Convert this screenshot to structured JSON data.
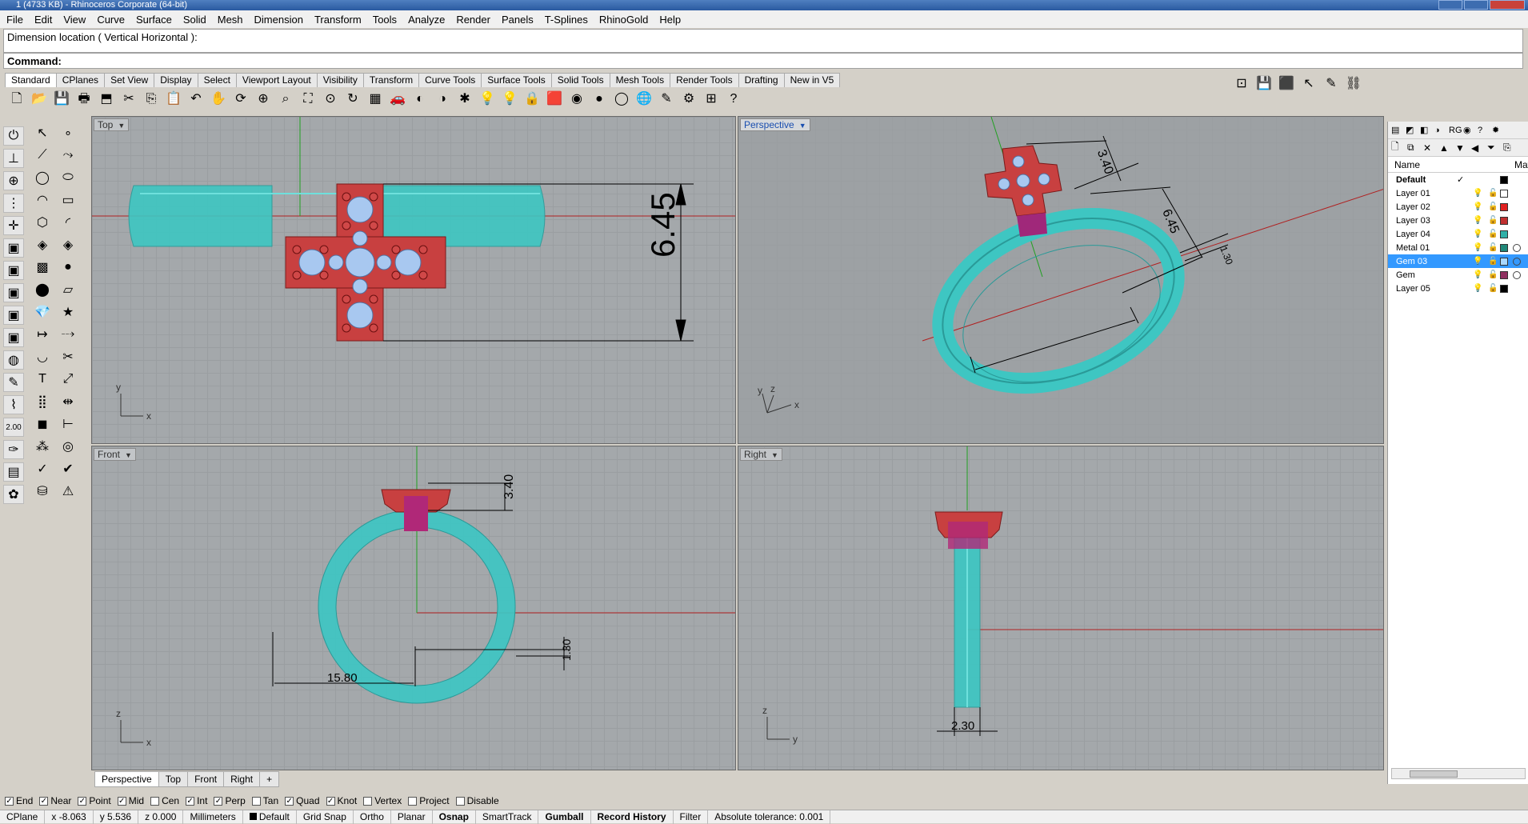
{
  "title": "1 (4733 KB) - Rhinoceros Corporate (64-bit)",
  "menu": [
    "File",
    "Edit",
    "View",
    "Curve",
    "Surface",
    "Solid",
    "Mesh",
    "Dimension",
    "Transform",
    "Tools",
    "Analyze",
    "Render",
    "Panels",
    "T-Splines",
    "RhinoGold",
    "Help"
  ],
  "command_history": "Dimension location ( Vertical  Horizontal ):",
  "command_prompt": "Command:",
  "toolbar_tabs": [
    "Standard",
    "CPlanes",
    "Set View",
    "Display",
    "Select",
    "Viewport Layout",
    "Visibility",
    "Transform",
    "Curve Tools",
    "Surface Tools",
    "Solid Tools",
    "Mesh Tools",
    "Render Tools",
    "Drafting",
    "New in V5"
  ],
  "toolbar_icons": [
    "new-icon",
    "open-icon",
    "save-icon",
    "print-icon",
    "import-icon",
    "cut-icon",
    "copy-icon",
    "paste-icon",
    "undo-icon",
    "pan-icon",
    "rotate-icon",
    "zoom-in-icon",
    "zoom-window-icon",
    "zoom-extents-icon",
    "zoom-selected-icon",
    "rotate-view-icon",
    "grid-icon",
    "car-icon",
    "hide-icon",
    "show-icon",
    "explode-icon",
    "light-icon",
    "light2-icon",
    "lock-icon",
    "render-icon",
    "color-wheel-icon",
    "sphere-icon",
    "sphere2-icon",
    "globe-icon",
    "pen-icon",
    "gear-icon",
    "extract-icon",
    "help-icon"
  ],
  "toolbar_glyphs": [
    "🗋",
    "📂",
    "💾",
    "🖶",
    "⬒",
    "✂",
    "⎘",
    "📋",
    "↶",
    "✋",
    "⟳",
    "⊕",
    "⌕",
    "⛶",
    "⊙",
    "↻",
    "▦",
    "🚗",
    "◐",
    "◑",
    "✱",
    "💡",
    "💡",
    "🔒",
    "🟥",
    "◉",
    "●",
    "◯",
    "🌐",
    "✎",
    "⚙",
    "⊞",
    "?"
  ],
  "right_toolbar_icons": [
    "viewport-icon",
    "save-small-icon",
    "cube-icon",
    "select-icon",
    "edit-icon",
    "link-icon"
  ],
  "right_toolbar_glyphs": [
    "⊡",
    "💾",
    "⬛",
    "↖",
    "✎",
    "⛓"
  ],
  "left_toolbar_col1": [
    "stop-icon",
    "cplane-icon",
    "globe-view-icon",
    "nodes-icon",
    "move-icon",
    "box-view-icon",
    "box-view2-icon",
    "box-view3-icon",
    "box-view4-icon",
    "box-view5-icon",
    "render-sphere-icon",
    "sketch-icon",
    "properties-icon",
    "zoom-value-icon",
    "tool-icon",
    "tool2-icon",
    "purple-gear-icon"
  ],
  "left_toolbar_col1_glyphs": [
    "⏻",
    "⊥",
    "⊕",
    "⋮",
    "✛",
    "▣",
    "▣",
    "▣",
    "▣",
    "▣",
    "◍",
    "✎",
    "⌇",
    "2.00",
    "✑",
    "▤",
    "✿"
  ],
  "left_toolbar_col2": [
    "select-arrow-icon",
    "point-icon",
    "polyline-icon",
    "curve-icon",
    "circle-icon",
    "ellipse-icon",
    "arc-icon",
    "rectangle-icon",
    "polygon-icon",
    "fillet-icon",
    "surface-icon",
    "surface2-icon",
    "box-icon",
    "sphere-tool-icon",
    "cylinder-icon",
    "plane-icon",
    "gem-icon",
    "star-icon",
    "extend-icon",
    "offset-icon",
    "blend-icon",
    "trim-icon",
    "text-icon",
    "scale-icon",
    "array-icon",
    "mirror-icon",
    "cube-tool-icon",
    "dimension-icon",
    "pattern-icon",
    "ring-icon",
    "check-icon",
    "tick-icon",
    "bucket-icon",
    "warning-icon"
  ],
  "left_toolbar_col2_glyphs": [
    "↖",
    "∘",
    "⟋",
    "⤳",
    "◯",
    "⬭",
    "◠",
    "▭",
    "⬡",
    "◜",
    "◈",
    "◈",
    "▩",
    "●",
    "⬤",
    "▱",
    "💎",
    "★",
    "↦",
    "⤏",
    "◡",
    "✂",
    "T",
    "⤢",
    "⣿",
    "⇹",
    "◼",
    "⊢",
    "⁂",
    "◎",
    "✓",
    "✔",
    "⛁",
    "⚠"
  ],
  "viewports": {
    "top": {
      "label": "Top",
      "dim": "6.45",
      "axis_x": "x",
      "axis_y": "y"
    },
    "perspective": {
      "label": "Perspective",
      "dim1": "3.40",
      "dim2": "6.45",
      "dim3": "1.30",
      "axis_x": "x",
      "axis_y": "y",
      "axis_z": "z"
    },
    "front": {
      "label": "Front",
      "dim1": "3.40",
      "dim2": "1.30",
      "dim3": "15.80",
      "axis_x": "x",
      "axis_z": "z"
    },
    "right": {
      "label": "Right",
      "dim": "2.30",
      "axis_y": "y",
      "axis_z": "z"
    }
  },
  "viewport_tabs": [
    "Perspective",
    "Top",
    "Front",
    "Right",
    "+"
  ],
  "layers": {
    "toolbar1_icons": [
      "layers-icon",
      "render-icon",
      "materials-icon",
      "env-icon",
      "rg-icon",
      "light-icon",
      "help-icon",
      "bulb-icon"
    ],
    "toolbar1_glyphs": [
      "▤",
      "◩",
      "◧",
      "◑",
      "RG",
      "◉",
      "?",
      "✹"
    ],
    "toolbar2_icons": [
      "new-layer-icon",
      "new-sublayer-icon",
      "delete-icon",
      "up-icon",
      "down-icon",
      "left-icon",
      "filter-icon",
      "copy-icon"
    ],
    "toolbar2_glyphs": [
      "🗋",
      "⧉",
      "✕",
      "▲",
      "▼",
      "◀",
      "⏷",
      "⎘"
    ],
    "header_name": "Name",
    "header_mat": "Mat",
    "rows": [
      {
        "name": "Default",
        "current": "✓",
        "color": "#000000",
        "bold": true
      },
      {
        "name": "Layer 01",
        "color": "#ffffff"
      },
      {
        "name": "Layer 02",
        "color": "#e02020"
      },
      {
        "name": "Layer 03",
        "color": "#c03030"
      },
      {
        "name": "Layer 04",
        "color": "#30b0a8"
      },
      {
        "name": "Metal 01",
        "color": "#208878",
        "mat": true
      },
      {
        "name": "Gem 03",
        "color": "#a8d8ff",
        "mat": true,
        "selected": true
      },
      {
        "name": "Gem",
        "color": "#903060",
        "mat": true
      },
      {
        "name": "Layer 05",
        "color": "#000000"
      }
    ]
  },
  "osnaps": [
    {
      "label": "End",
      "on": true
    },
    {
      "label": "Near",
      "on": true
    },
    {
      "label": "Point",
      "on": true
    },
    {
      "label": "Mid",
      "on": true
    },
    {
      "label": "Cen",
      "on": false
    },
    {
      "label": "Int",
      "on": true
    },
    {
      "label": "Perp",
      "on": true
    },
    {
      "label": "Tan",
      "on": false
    },
    {
      "label": "Quad",
      "on": true
    },
    {
      "label": "Knot",
      "on": true
    },
    {
      "label": "Vertex",
      "on": false
    },
    {
      "label": "Project",
      "on": false
    },
    {
      "label": "Disable",
      "on": false
    }
  ],
  "status": {
    "cplane": "CPlane",
    "x": "x -8.063",
    "y": "y 5.536",
    "z": "z 0.000",
    "units": "Millimeters",
    "layer": "Default",
    "grid_snap": "Grid Snap",
    "ortho": "Ortho",
    "planar": "Planar",
    "osnap": "Osnap",
    "smarttrack": "SmartTrack",
    "gumball": "Gumball",
    "record_history": "Record History",
    "filter": "Filter",
    "tolerance": "Absolute tolerance: 0.001"
  },
  "colors": {
    "ring": "#3ec6c2",
    "gem_setting": "#c83a3a",
    "gem": "#a8c8f0",
    "axis_x": "#b02020",
    "axis_y": "#20a020",
    "selection": "#3399ff"
  }
}
